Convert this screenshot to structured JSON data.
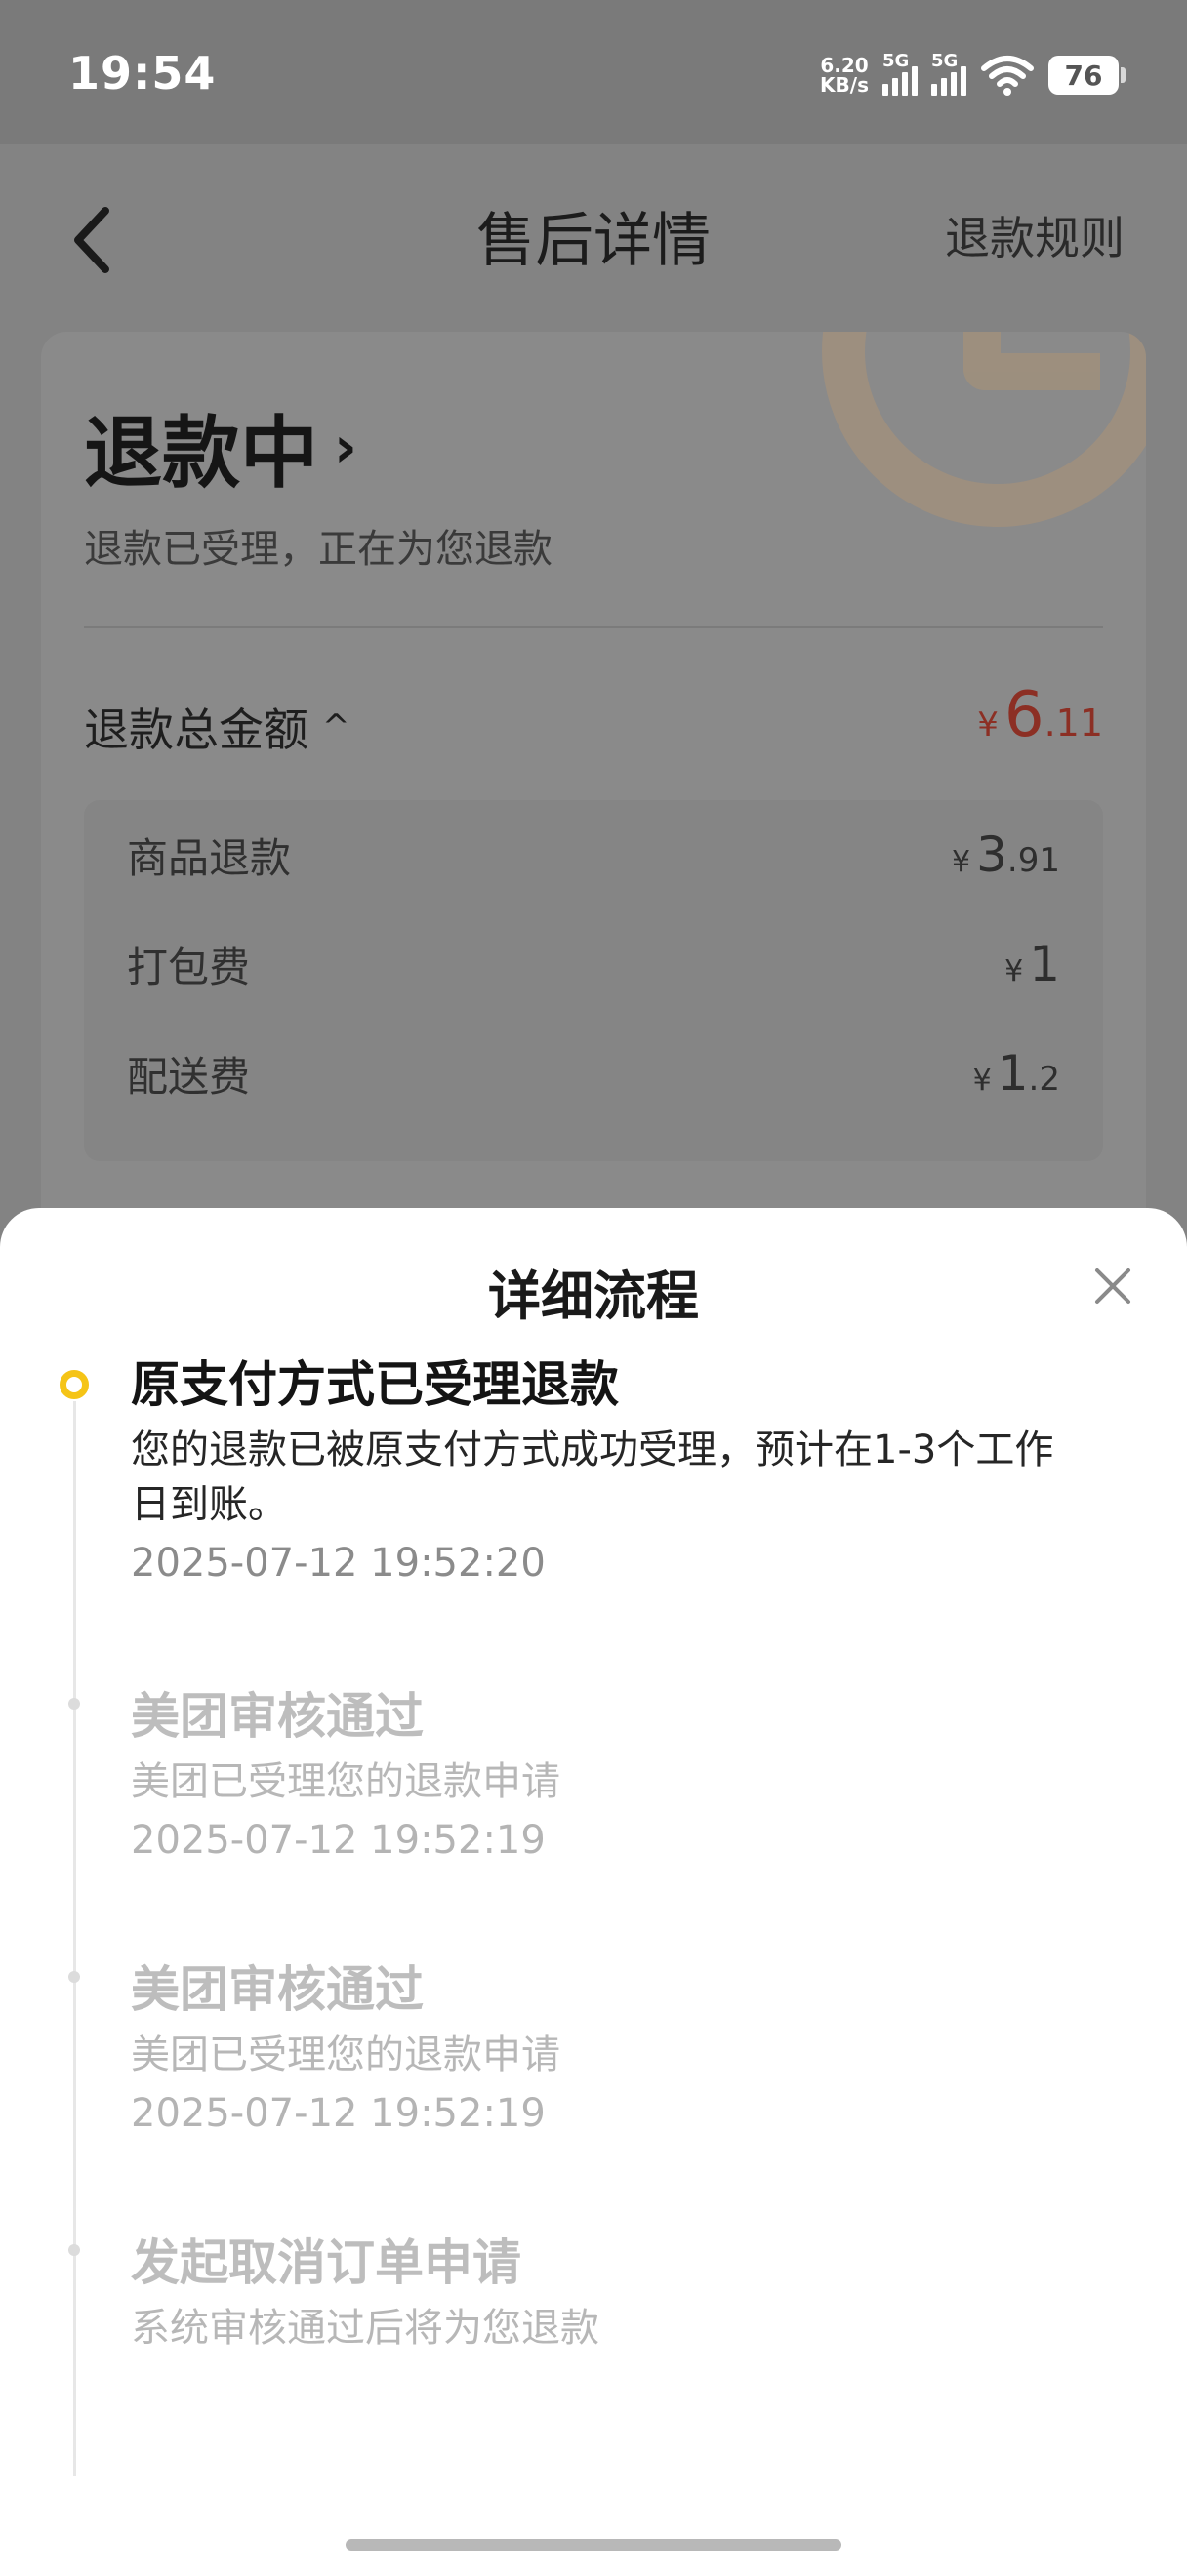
{
  "status_bar": {
    "time": "19:54",
    "net_speed_value": "6.20",
    "net_speed_unit": "KB/s",
    "sim1_label": "5G",
    "sim2_label": "5G",
    "battery": "76"
  },
  "header": {
    "title": "售后详情",
    "right_link": "退款规则"
  },
  "refund_card": {
    "status": "退款中",
    "status_chevron": "›",
    "subtitle": "退款已受理，正在为您退款",
    "total_label": "退款总金额",
    "total_caret": "^",
    "total_currency": "¥",
    "total_int": "6",
    "total_dec": ".11",
    "breakdown": [
      {
        "label": "商品退款",
        "currency": "¥",
        "int": "3",
        "dec": ".91"
      },
      {
        "label": "打包费",
        "currency": "¥",
        "int": "1",
        "dec": ""
      },
      {
        "label": "配送费",
        "currency": "¥",
        "int": "1",
        "dec": ".2"
      }
    ]
  },
  "sheet": {
    "title": "详细流程",
    "steps": [
      {
        "title": "原支付方式已受理退款",
        "desc": "您的退款已被原支付方式成功受理，预计在1-3个工作日到账。",
        "time": "2025-07-12 19:52:20"
      },
      {
        "title": "美团审核通过",
        "desc": "美团已受理您的退款申请",
        "time": "2025-07-12 19:52:19"
      },
      {
        "title": "美团审核通过",
        "desc": "美团已受理您的退款申请",
        "time": "2025-07-12 19:52:19"
      },
      {
        "title": "发起取消订单申请",
        "desc": "系统审核通过后将为您退款",
        "time": ""
      }
    ]
  },
  "colors": {
    "accent_yellow": "#f5c417",
    "price_red": "#8c2f24",
    "overlay_gray": "#838383"
  }
}
